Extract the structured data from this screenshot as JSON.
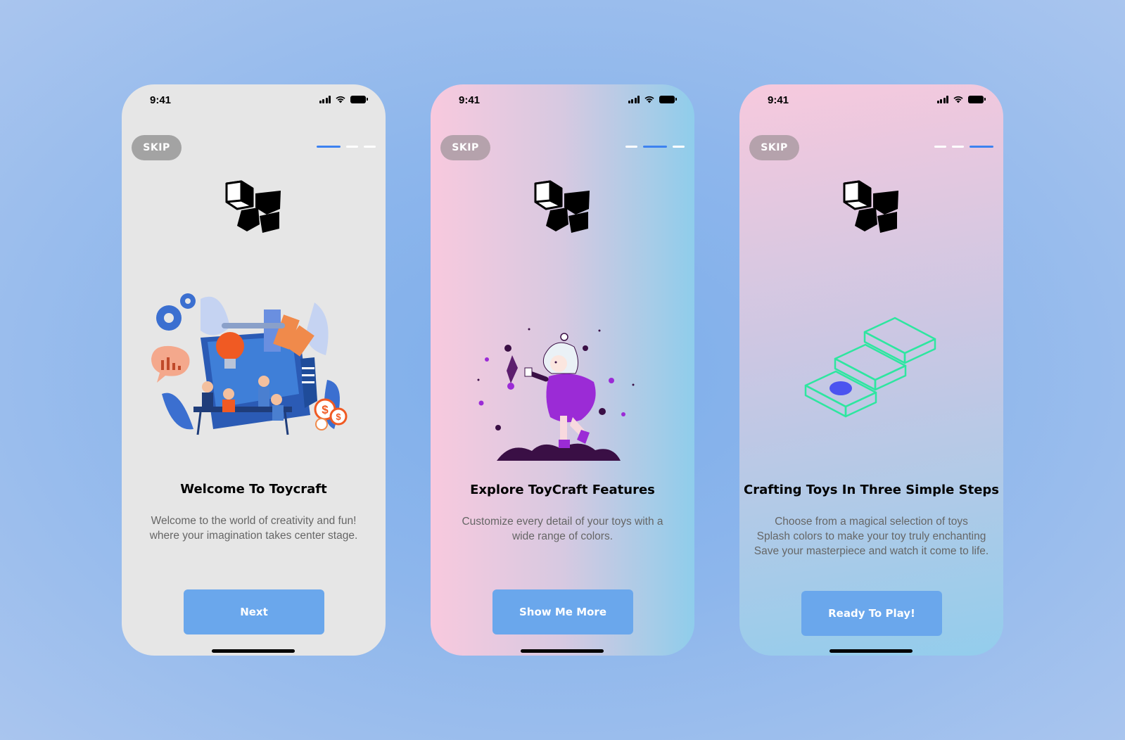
{
  "screens": [
    {
      "status": {
        "time": "9:41"
      },
      "skip_label": "SKIP",
      "active_step": 1,
      "title": "Welcome To Toycraft",
      "description_lines": [
        "Welcome to the world of creativity and fun!",
        "where your imagination takes center stage."
      ],
      "button_label": "Next",
      "background": "#e6e6e6"
    },
    {
      "status": {
        "time": "9:41"
      },
      "skip_label": "SKIP",
      "active_step": 2,
      "title": "Explore ToyCraft Features",
      "description_lines": [
        "Customize every detail of your toys with a",
        "wide range of colors."
      ],
      "button_label": "Show Me More",
      "background": [
        "#f8c9de",
        "#8fcdeb"
      ]
    },
    {
      "status": {
        "time": "9:41"
      },
      "skip_label": "SKIP",
      "active_step": 3,
      "title": "Crafting Toys In Three Simple Steps",
      "description_lines": [
        "Choose from a magical selection of toys",
        "Splash colors to make your toy truly enchanting",
        "Save your masterpiece and watch it come to life."
      ],
      "button_label": "Ready To Play!",
      "background": [
        "#f7c9dd",
        "#93cdec"
      ]
    }
  ],
  "colors": {
    "accent": "#3d82f0",
    "button": "#6aa7ec",
    "steps_illustration": "#2ee6a0"
  },
  "icons": [
    "signal-icon",
    "wifi-icon",
    "battery-icon",
    "toycraft-logo-icon"
  ]
}
